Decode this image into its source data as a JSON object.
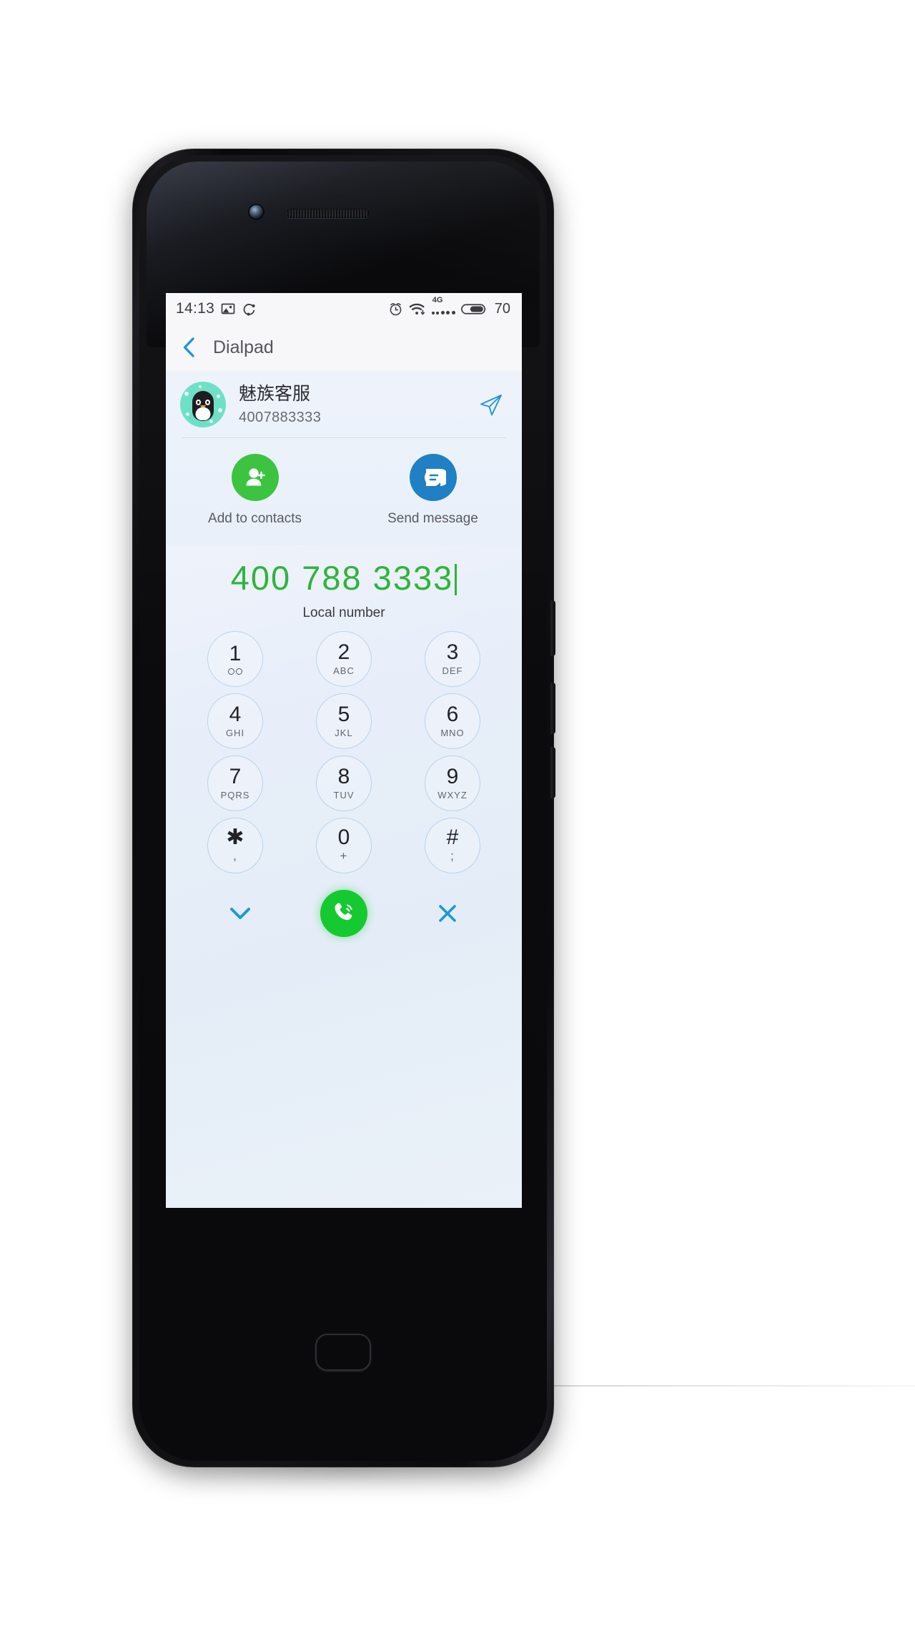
{
  "statusbar": {
    "time": "14:13",
    "left_icons": [
      "image-icon",
      "sync-icon"
    ],
    "right_icons": [
      "alarm-icon",
      "wifi-icon",
      "signal-icon",
      "battery-icon"
    ],
    "network_label": "4G",
    "battery_level": "70"
  },
  "navbar": {
    "back_icon": "chevron-left-icon",
    "title": "Dialpad"
  },
  "contact": {
    "avatar": "penguin-avatar",
    "name": "魅族客服",
    "number": "4007883333",
    "send_icon": "send-plane-icon"
  },
  "actions": [
    {
      "icon": "add-contact-icon",
      "label": "Add to contacts",
      "color": "#3cc440"
    },
    {
      "icon": "message-bubble-icon",
      "label": "Send message",
      "color": "#1f80c4"
    }
  ],
  "dial": {
    "number": "400 788 3333",
    "number_color": "#2fb43c",
    "subtitle": "Local number",
    "keys": [
      {
        "digit": "1",
        "sub": "",
        "icon": "voicemail-icon"
      },
      {
        "digit": "2",
        "sub": "ABC",
        "icon": ""
      },
      {
        "digit": "3",
        "sub": "DEF",
        "icon": ""
      },
      {
        "digit": "4",
        "sub": "GHI",
        "icon": ""
      },
      {
        "digit": "5",
        "sub": "JKL",
        "icon": ""
      },
      {
        "digit": "6",
        "sub": "MNO",
        "icon": ""
      },
      {
        "digit": "7",
        "sub": "PQRS",
        "icon": ""
      },
      {
        "digit": "8",
        "sub": "TUV",
        "icon": ""
      },
      {
        "digit": "9",
        "sub": "WXYZ",
        "icon": ""
      },
      {
        "digit": "✱",
        "sub": ",",
        "icon": ""
      },
      {
        "digit": "0",
        "sub": "+",
        "icon": ""
      },
      {
        "digit": "#",
        "sub": ";",
        "icon": ""
      }
    ],
    "bottom": {
      "hide_icon": "chevron-down-icon",
      "call_icon": "phone-call-icon",
      "delete_icon": "close-x-icon",
      "accent_blue": "#2196d9",
      "call_green": "#15c930"
    }
  }
}
